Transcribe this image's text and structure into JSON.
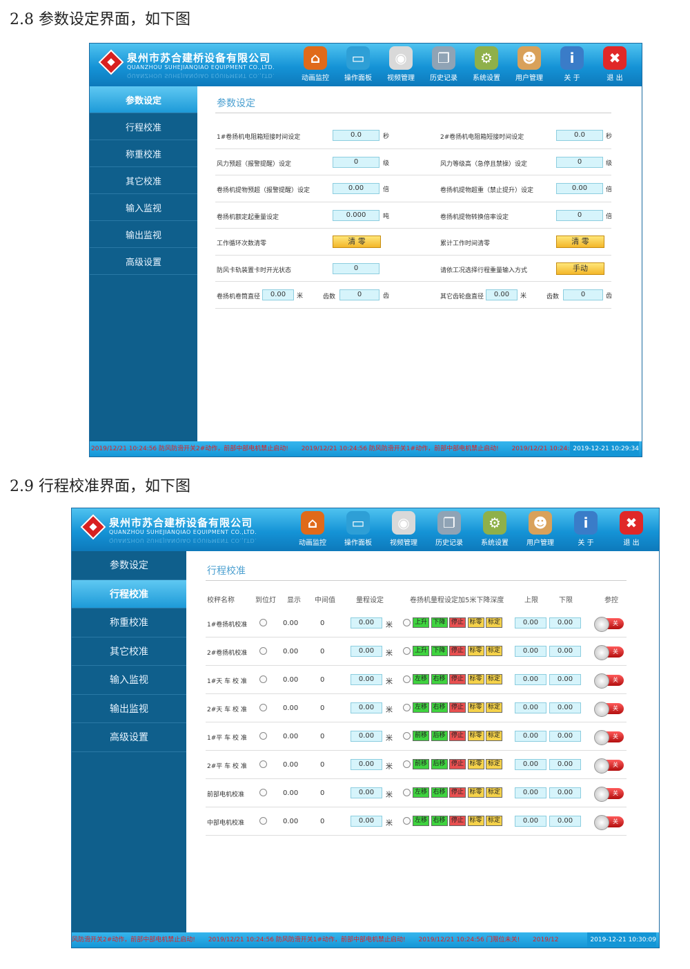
{
  "section1_title": "2.8 参数设定界面，如下图",
  "section2_title": "2.9 行程校准界面，如下图",
  "company": {
    "cn": "泉州市苏合建桥设备有限公司",
    "en": "QUANZHOU SUHEJIANQIAO EQUIPMENT CO.,LTD."
  },
  "toolbar": [
    {
      "label": "动画监控",
      "icon": "home-icon",
      "color": "#e06a1a",
      "glyph": "⌂"
    },
    {
      "label": "操作面板",
      "icon": "monitor-icon",
      "color": "#2e9fd6",
      "glyph": "▭"
    },
    {
      "label": "视频管理",
      "icon": "camera-icon",
      "color": "#d9d9d9",
      "glyph": "◉"
    },
    {
      "label": "历史记录",
      "icon": "documents-icon",
      "color": "#8fa3b5",
      "glyph": "❐"
    },
    {
      "label": "系统设置",
      "icon": "gear-icon",
      "color": "#8fb04a",
      "glyph": "⚙"
    },
    {
      "label": "用户管理",
      "icon": "user-icon",
      "color": "#d9a15a",
      "glyph": "☻"
    },
    {
      "label": "关 于",
      "icon": "info-icon",
      "color": "#3a7cc8",
      "glyph": "i"
    },
    {
      "label": "退 出",
      "icon": "exit-icon",
      "color": "#e02828",
      "glyph": "✖"
    }
  ],
  "sidebar": [
    "参数设定",
    "行程校准",
    "称重校准",
    "其它校准",
    "输入监视",
    "输出监视",
    "高级设置"
  ],
  "param": {
    "title": "参数设定",
    "rows": [
      {
        "l1": "1#卷扬机电阻箱短接时间设定",
        "v1": "0.0",
        "u1": "秒",
        "l2": "2#卷扬机电阻箱短接时间设定",
        "v2": "0.0",
        "u2": "秒"
      },
      {
        "l1": "风力预超（报警提醒）设定",
        "v1": "0",
        "u1": "级",
        "l2": "风力等级高（急停且禁操）设定",
        "v2": "0",
        "u2": "级"
      },
      {
        "l1": "卷扬机提物预超（报警提醒）设定",
        "v1": "0.00",
        "u1": "倍",
        "l2": "卷扬机提物超重（禁止提升）设定",
        "v2": "0.00",
        "u2": "倍"
      },
      {
        "l1": "卷扬机额定起重量设定",
        "v1": "0.000",
        "u1": "吨",
        "l2": "卷扬机提物转换倍率设定",
        "v2": "0",
        "u2": "倍"
      }
    ],
    "clear_row": {
      "l1": "工作循环次数清零",
      "b1": "清 零",
      "l2": "累计工作时间清零",
      "b2": "清 零"
    },
    "switch_row": {
      "l1": "防风卡轨装置卡时开光状态",
      "v1": "0",
      "l2": "请依工况选择行程重量输入方式",
      "b2": "手动"
    },
    "drum_row": {
      "l1": "卷扬机卷筒直径",
      "v1": "0.00",
      "u1": "米",
      "t1": "齿数",
      "c1": "0",
      "cu1": "齿",
      "l2": "其它齿轮盘直径",
      "v2": "0.00",
      "u2": "米",
      "t2": "齿数",
      "c2": "0",
      "cu2": "齿"
    },
    "status": {
      "m1": "2019/12/21 10:24:56 防风防滑开关2#动作，前部中部电机禁止启动!",
      "m2": "2019/12/21 10:24:56 防风防滑开关1#动作，前部中部电机禁止启动!",
      "m3": "2019/12/21 10:24:56",
      "clock": "2019-12-21 10:29:34"
    }
  },
  "travel": {
    "title": "行程校准",
    "headers": [
      "校秤名称",
      "到位灯",
      "显示",
      "中间值",
      "量程设定",
      "卷扬机量程设定加5米下降深度",
      "上限",
      "下限",
      "参控"
    ],
    "rows": [
      {
        "name": "1#卷扬机校准",
        "disp": "0.00",
        "mid": "0",
        "range": "0.00",
        "unit": "米",
        "b1": "上升",
        "b2": "下降",
        "b3": "停止",
        "b4": "标零",
        "b5": "标定",
        "up": "0.00",
        "low": "0.00",
        "toggle": "关"
      },
      {
        "name": "2#卷扬机校准",
        "disp": "0.00",
        "mid": "0",
        "range": "0.00",
        "unit": "米",
        "b1": "上升",
        "b2": "下降",
        "b3": "停止",
        "b4": "标零",
        "b5": "标定",
        "up": "0.00",
        "low": "0.00",
        "toggle": "关"
      },
      {
        "name": "1#天 车 校 准",
        "disp": "0.00",
        "mid": "0",
        "range": "0.00",
        "unit": "米",
        "b1": "左移",
        "b2": "右移",
        "b3": "停止",
        "b4": "标零",
        "b5": "标定",
        "up": "0.00",
        "low": "0.00",
        "toggle": "关"
      },
      {
        "name": "2#天 车 校 准",
        "disp": "0.00",
        "mid": "0",
        "range": "0.00",
        "unit": "米",
        "b1": "左移",
        "b2": "右移",
        "b3": "停止",
        "b4": "标零",
        "b5": "标定",
        "up": "0.00",
        "low": "0.00",
        "toggle": "关"
      },
      {
        "name": "1#平 车 校 准",
        "disp": "0.00",
        "mid": "0",
        "range": "0.00",
        "unit": "米",
        "b1": "前移",
        "b2": "后移",
        "b3": "停止",
        "b4": "标零",
        "b5": "标定",
        "up": "0.00",
        "low": "0.00",
        "toggle": "关"
      },
      {
        "name": "2#平 车 校 准",
        "disp": "0.00",
        "mid": "0",
        "range": "0.00",
        "unit": "米",
        "b1": "前移",
        "b2": "后移",
        "b3": "停止",
        "b4": "标零",
        "b5": "标定",
        "up": "0.00",
        "low": "0.00",
        "toggle": "关"
      },
      {
        "name": "前部电机校准",
        "disp": "0.00",
        "mid": "0",
        "range": "0.00",
        "unit": "米",
        "b1": "左移",
        "b2": "右移",
        "b3": "停止",
        "b4": "标零",
        "b5": "标定",
        "up": "0.00",
        "low": "0.00",
        "toggle": "关"
      },
      {
        "name": "中部电机校准",
        "disp": "0.00",
        "mid": "0",
        "range": "0.00",
        "unit": "米",
        "b1": "左移",
        "b2": "右移",
        "b3": "停止",
        "b4": "标零",
        "b5": "标定",
        "up": "0.00",
        "low": "0.00",
        "toggle": "关"
      }
    ],
    "status": {
      "m1": "风防滑开关2#动作，前部中部电机禁止启动!",
      "m2": "2019/12/21 10:24:56 防风防滑开关1#动作，前部中部电机禁止启动!",
      "m3": "2019/12/21 10:24:56 门限位未关!",
      "m4": "2019/12",
      "clock": "2019-12-21 10:30:09"
    }
  }
}
